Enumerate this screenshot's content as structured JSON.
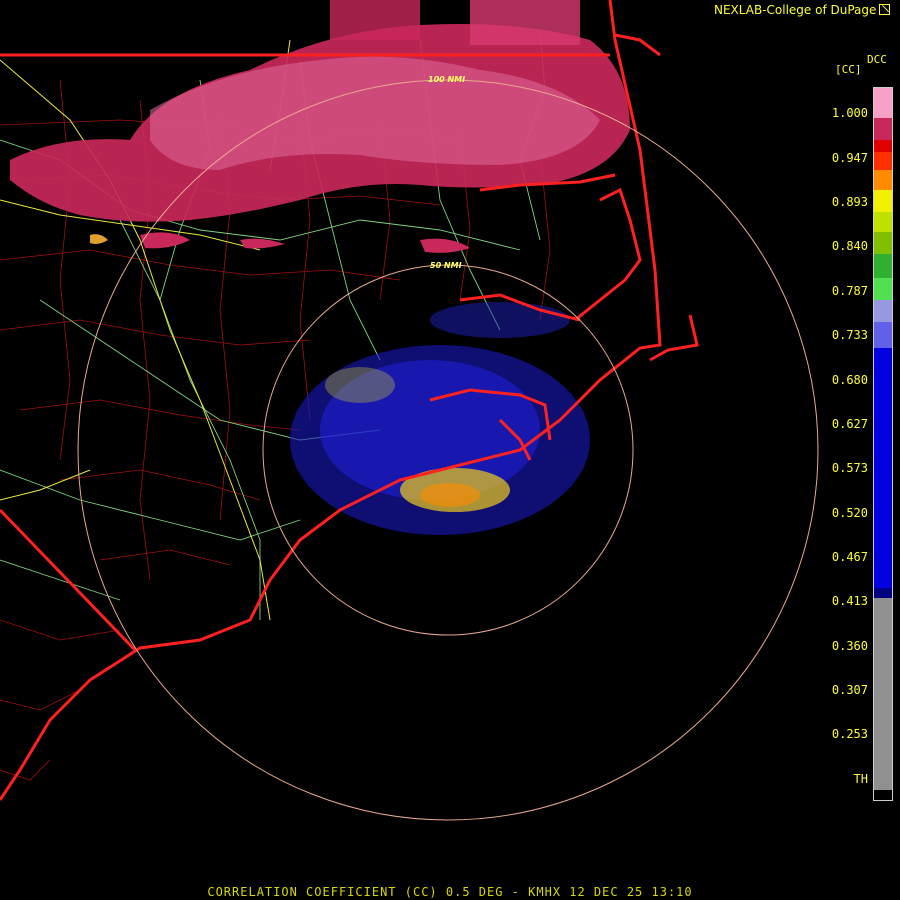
{
  "header": {
    "credit": "NEXLAB-College of DuPage",
    "credit_icon": "map-cursor-icon",
    "product_code": "DCC",
    "unit": "[CC]"
  },
  "legend": {
    "ticks": [
      "1.000",
      "0.947",
      "0.893",
      "0.840",
      "0.787",
      "0.733",
      "0.680",
      "0.627",
      "0.573",
      "0.520",
      "0.467",
      "0.413",
      "0.360",
      "0.307",
      "0.253",
      "TH"
    ],
    "colors": {
      "high_pink": "#f7a0c8",
      "crimson": "#c8285a",
      "red": "#e00000",
      "orange": "#ff8c00",
      "yellow": "#f0f000",
      "green": "#50e050",
      "lavender": "#9898e0",
      "blue": "#0000e0",
      "navy": "#000080",
      "gray": "#909090",
      "threshold": "#000000"
    }
  },
  "range_rings": {
    "labels": [
      "50 NMI",
      "100 NMI"
    ]
  },
  "radar": {
    "site": "KMHX"
  },
  "footer": {
    "caption": "CORRELATION COEFFICIENT (CC) 0.5 DEG - KMHX 12 DEC 25 13:10"
  }
}
